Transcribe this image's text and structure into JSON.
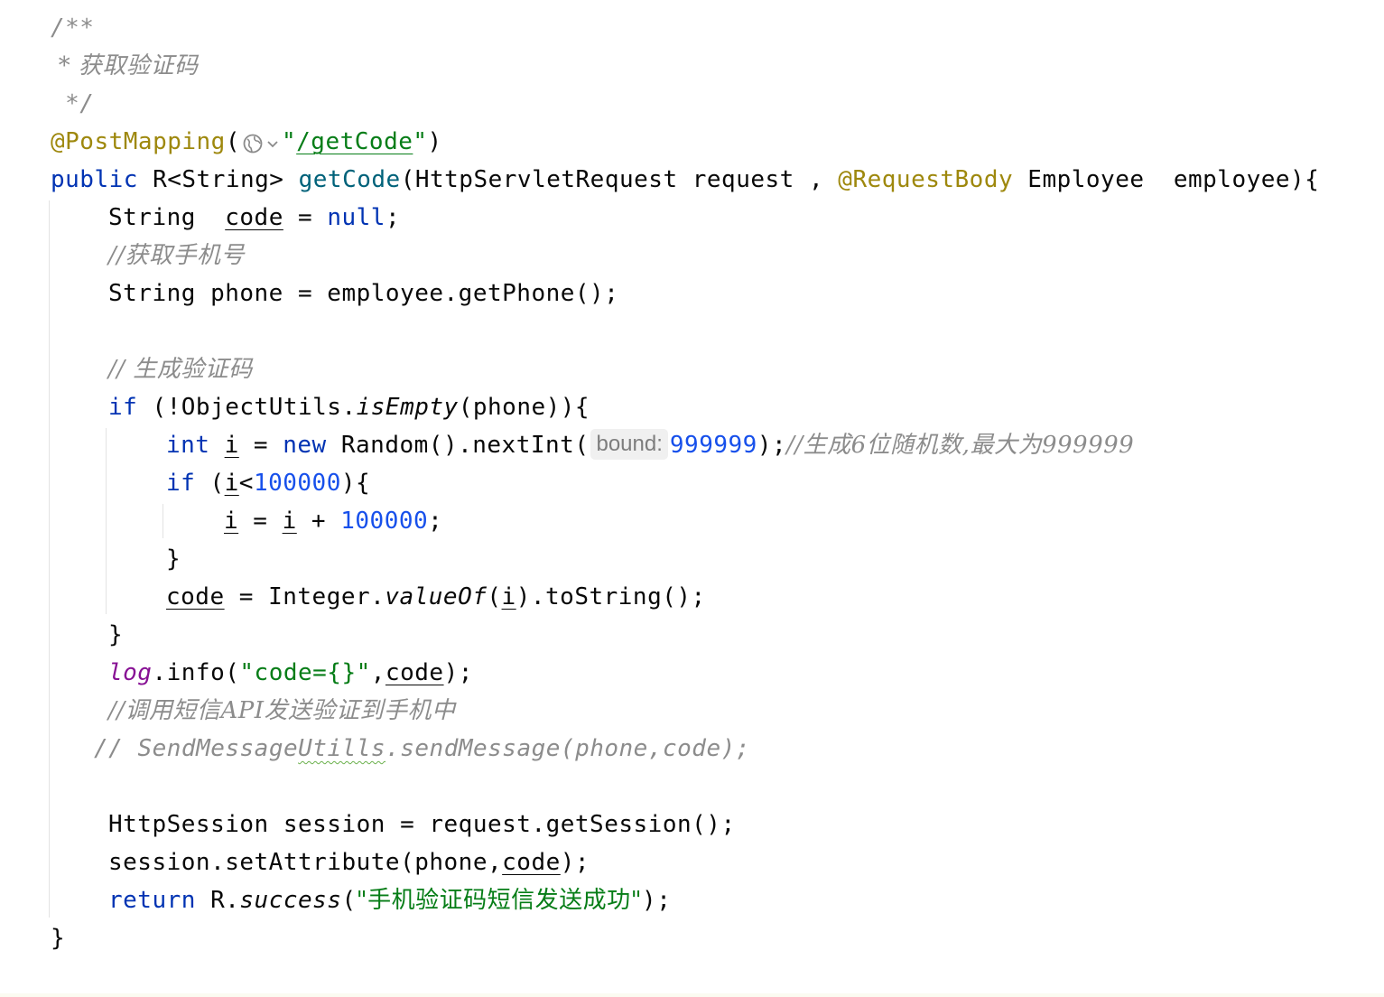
{
  "code": {
    "l1": {
      "c": "/**"
    },
    "l2": {
      "c": " * 获取验证码"
    },
    "l3": {
      "c": " */"
    },
    "l4": {
      "ann": "@PostMapping",
      "p1": "(",
      "q1": "\"",
      "path": "/getCode",
      "q2": "\"",
      "p2": ")"
    },
    "l5": {
      "kw": "public",
      "t1": " R<String> ",
      "fn": "getCode",
      "t2": "(HttpServletRequest request , ",
      "ann": "@RequestBody",
      "t3": " Employee  employee){"
    },
    "l6": {
      "t1": "String  ",
      "var": "code",
      "t2": " = ",
      "kw": "null",
      "t3": ";"
    },
    "l7": {
      "c": "//获取手机号"
    },
    "l8": {
      "t": "String phone = employee.getPhone();"
    },
    "l9": {
      "c": "// 生成验证码"
    },
    "l10": {
      "kw": "if",
      "t1": " (!ObjectUtils.",
      "it": "isEmpty",
      "t2": "(phone)){"
    },
    "l11": {
      "kw1": "int",
      "sp1": " ",
      "var": "i",
      "t1": " = ",
      "kw2": "new",
      "t2": " Random().nextInt(",
      "hint": "bound:",
      "num": "999999",
      "t3": ");",
      "c": "//生成6位随机数,最大为999999"
    },
    "l12": {
      "kw": "if",
      "t1": " (",
      "var": "i",
      "t2": "<",
      "num": "100000",
      "t3": "){"
    },
    "l13": {
      "v1": "i",
      "t1": " = ",
      "v2": "i",
      "t2": " + ",
      "num": "100000",
      "t3": ";"
    },
    "l14": {
      "t": "}"
    },
    "l15": {
      "var": "code",
      "t1": " = Integer.",
      "it": "valueOf",
      "t2": "(",
      "v2": "i",
      "t3": ").toString();"
    },
    "l16": {
      "t": "}"
    },
    "l17": {
      "fld": "log",
      "t1": ".info(",
      "str": "\"code={}\"",
      "t2": ",",
      "var": "code",
      "t3": ");"
    },
    "l18": {
      "c": "//调用短信API发送验证到手机中"
    },
    "l19": {
      "c1": "// SendMessage",
      "wavy": "Utills",
      "c2": ".sendMessage(phone,code);"
    },
    "l20": {
      "t": "HttpSession session = request.getSession();"
    },
    "l21": {
      "t1": "session.setAttribute(phone,",
      "var": "code",
      "t2": ");"
    },
    "l22": {
      "kw": "return",
      "t1": " R.",
      "it": "success",
      "t2": "(",
      "str": "\"手机验证码短信发送成功\"",
      "t3": ");"
    },
    "l23": {
      "t": "}"
    }
  },
  "icons": {
    "url_inlay": "globe-icon",
    "url_inlay_dropdown": "chevron-down-icon"
  },
  "colors": {
    "keyword": "#0033b3",
    "annotation": "#9e880d",
    "method_decl": "#00627a",
    "number": "#1750eb",
    "string": "#067d17",
    "comment": "#8c8c8c",
    "field": "#871094"
  }
}
